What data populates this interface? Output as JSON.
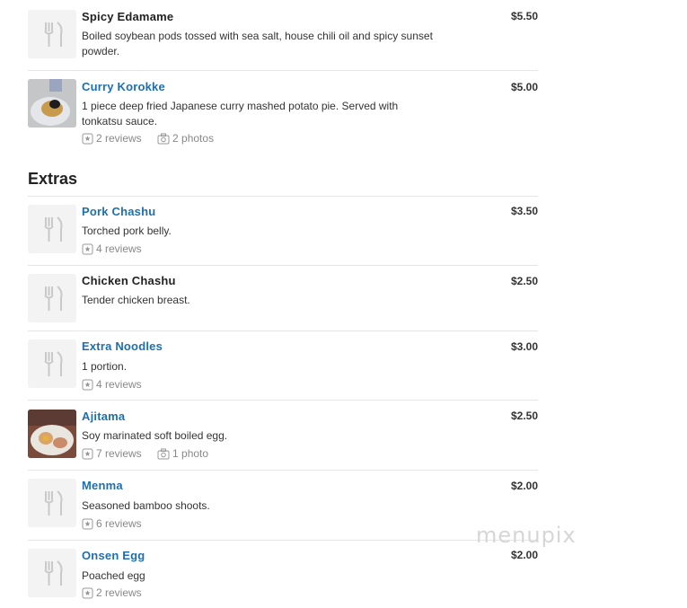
{
  "top_items": [
    {
      "name": "Spicy Edamame",
      "price": "$5.50",
      "desc": "Boiled soybean pods tossed with sea salt, house chili oil and spicy sunset powder.",
      "reviews": "",
      "photos": ""
    },
    {
      "name": "Curry Korokke",
      "price": "$5.00",
      "desc": "1 piece deep fried Japanese curry mashed potato pie. Served with tonkatsu sauce.",
      "reviews": "2 reviews",
      "photos": "2 photos"
    }
  ],
  "section": {
    "title": "Extras"
  },
  "extras": [
    {
      "name": "Pork Chashu",
      "price": "$3.50",
      "desc": "Torched pork belly.",
      "reviews": "4 reviews",
      "photos": ""
    },
    {
      "name": "Chicken Chashu",
      "price": "$2.50",
      "desc": "Tender chicken breast.",
      "reviews": "",
      "photos": ""
    },
    {
      "name": "Extra Noodles",
      "price": "$3.00",
      "desc": "1 portion.",
      "reviews": "4 reviews",
      "photos": ""
    },
    {
      "name": "Ajitama",
      "price": "$2.50",
      "desc": "Soy marinated soft boiled egg.",
      "reviews": "7 reviews",
      "photos": "1 photo"
    },
    {
      "name": "Menma",
      "price": "$2.00",
      "desc": "Seasoned bamboo shoots.",
      "reviews": "6 reviews",
      "photos": ""
    },
    {
      "name": "Onsen Egg",
      "price": "$2.00",
      "desc": "Poached egg",
      "reviews": "2 reviews",
      "photos": ""
    }
  ],
  "watermark": "menupix",
  "icons": {
    "placeholder": "utensils-icon",
    "reviews": "star-badge-icon",
    "photos": "camera-icon"
  },
  "colors": {
    "link": "#1e6fb0",
    "text": "#333333",
    "meta": "#888888",
    "divider": "#e6e6e6"
  }
}
